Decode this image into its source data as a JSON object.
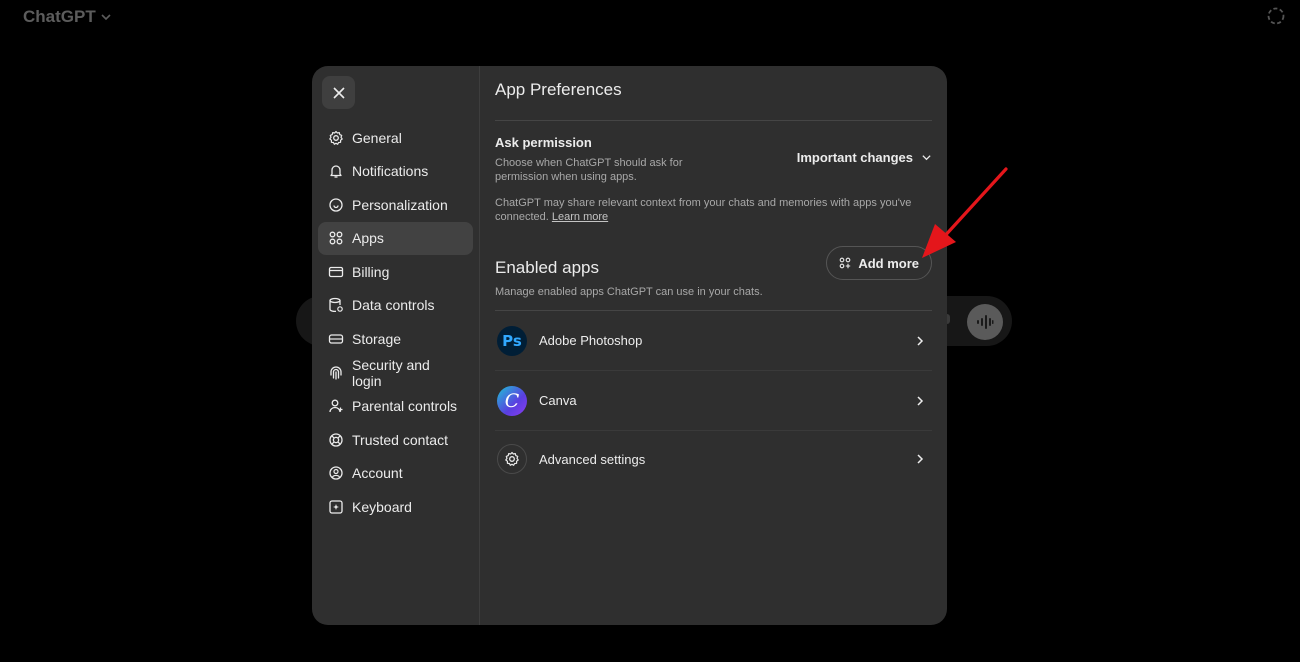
{
  "header": {
    "app_title": "ChatGPT"
  },
  "sidebar": {
    "items": [
      {
        "label": "General",
        "icon": "gear-icon"
      },
      {
        "label": "Notifications",
        "icon": "bell-icon"
      },
      {
        "label": "Personalization",
        "icon": "personalization-icon"
      },
      {
        "label": "Apps",
        "icon": "apps-grid-icon",
        "active": true
      },
      {
        "label": "Billing",
        "icon": "card-icon"
      },
      {
        "label": "Data controls",
        "icon": "database-icon"
      },
      {
        "label": "Storage",
        "icon": "storage-icon"
      },
      {
        "label": "Security and login",
        "icon": "fingerprint-icon"
      },
      {
        "label": "Parental controls",
        "icon": "person-icon"
      },
      {
        "label": "Trusted contact",
        "icon": "lifebuoy-icon"
      },
      {
        "label": "Account",
        "icon": "account-icon"
      },
      {
        "label": "Keyboard",
        "icon": "keyboard-icon"
      }
    ]
  },
  "main": {
    "title": "App Preferences",
    "permission": {
      "title": "Ask permission",
      "description": "Choose when ChatGPT should ask for permission when using apps.",
      "selected": "Important changes"
    },
    "note": "ChatGPT may share relevant context from your chats and memories with apps you've connected.",
    "note_link": "Learn more",
    "enabled": {
      "title": "Enabled apps",
      "description": "Manage enabled apps ChatGPT can use in your chats.",
      "add_more": "Add more"
    },
    "apps": [
      {
        "label": "Adobe Photoshop",
        "icon_text": "Ps"
      },
      {
        "label": "Canva",
        "icon_text": "C"
      },
      {
        "label": "Advanced settings"
      }
    ]
  },
  "colors": {
    "modal_bg": "#2f2f2f",
    "annotation_arrow": "#e4161b"
  }
}
